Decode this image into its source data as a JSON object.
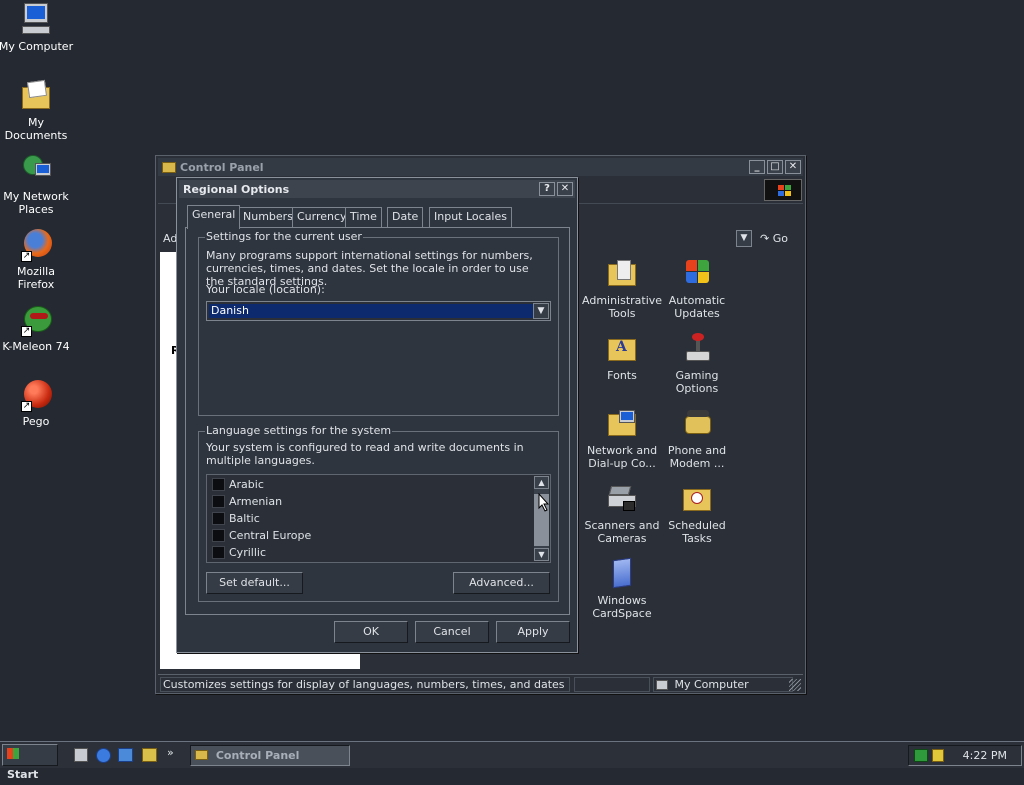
{
  "desktop": {
    "icons": [
      {
        "label": "My Computer",
        "icon": "my-computer-icon"
      },
      {
        "label": "My Documents",
        "icon": "my-documents-icon"
      },
      {
        "label": "My Network Places",
        "icon": "network-places-icon"
      },
      {
        "label": "Mozilla Firefox",
        "icon": "firefox-icon"
      },
      {
        "label": "K-Meleon 74",
        "icon": "k-meleon-icon"
      },
      {
        "label": "Pego",
        "icon": "pego-icon"
      }
    ]
  },
  "control_panel": {
    "title": "Control Panel",
    "address_label": "Ad",
    "go_label": "Go",
    "items": [
      {
        "label": "Administrative Tools",
        "icon": "administrative-tools-icon"
      },
      {
        "label": "Automatic Updates",
        "icon": "automatic-updates-icon"
      },
      {
        "label": "Fonts",
        "icon": "fonts-folder-icon"
      },
      {
        "label": "Gaming Options",
        "icon": "gaming-options-icon"
      },
      {
        "label": "Network and Dial-up Co...",
        "icon": "network-dialup-icon"
      },
      {
        "label": "Phone and Modem ...",
        "icon": "phone-modem-icon"
      },
      {
        "label": "Scanners and Cameras",
        "icon": "scanners-cameras-icon"
      },
      {
        "label": "Scheduled Tasks",
        "icon": "scheduled-tasks-icon"
      },
      {
        "label": "Windows CardSpace",
        "icon": "cardspace-icon"
      }
    ],
    "status_text": "Customizes settings for display of languages, numbers, times, and dates",
    "status_zone": "My Computer"
  },
  "dialog": {
    "title": "Regional Options",
    "help_label": "?",
    "close_label": "✕",
    "tabs": [
      "General",
      "Numbers",
      "Currency",
      "Time",
      "Date",
      "Input Locales"
    ],
    "user_group": {
      "title": "Settings for the current user",
      "description": "Many programs support international settings for numbers, currencies, times, and dates. Set the locale in order to use the standard settings.",
      "locale_label": "Your locale (location):",
      "locale_value": "Danish"
    },
    "system_group": {
      "title": "Language settings for the system",
      "description": "Your system is configured to read and write documents in multiple languages.",
      "languages": [
        "Arabic",
        "Armenian",
        "Baltic",
        "Central Europe",
        "Cyrillic"
      ],
      "set_default_label": "Set default...",
      "advanced_label": "Advanced..."
    },
    "ok_label": "OK",
    "cancel_label": "Cancel",
    "apply_label": "Apply"
  },
  "taskbar": {
    "start_label": "Start",
    "task_label": "Control Panel",
    "clock": "4:22 PM"
  }
}
